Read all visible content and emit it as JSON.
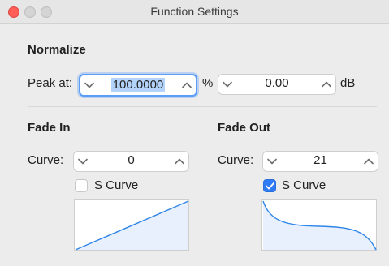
{
  "window": {
    "title": "Function Settings"
  },
  "normalize": {
    "heading": "Normalize",
    "peak_label": "Peak at:",
    "percent_value": "100.0000",
    "percent_unit": "%",
    "db_value": "0.00",
    "db_unit": "dB"
  },
  "fade_in": {
    "heading": "Fade In",
    "curve_label": "Curve:",
    "curve_value": "0",
    "s_curve_label": "S Curve",
    "s_curve_checked": false
  },
  "fade_out": {
    "heading": "Fade Out",
    "curve_label": "Curve:",
    "curve_value": "21",
    "s_curve_label": "S Curve",
    "s_curve_checked": true
  },
  "colors": {
    "accent": "#2f7cf6",
    "curve_line": "#2f86e8",
    "curve_fill": "#e7f0fc"
  },
  "icons": [
    "chevron-down-icon",
    "chevron-up-icon",
    "checkmark-icon"
  ]
}
